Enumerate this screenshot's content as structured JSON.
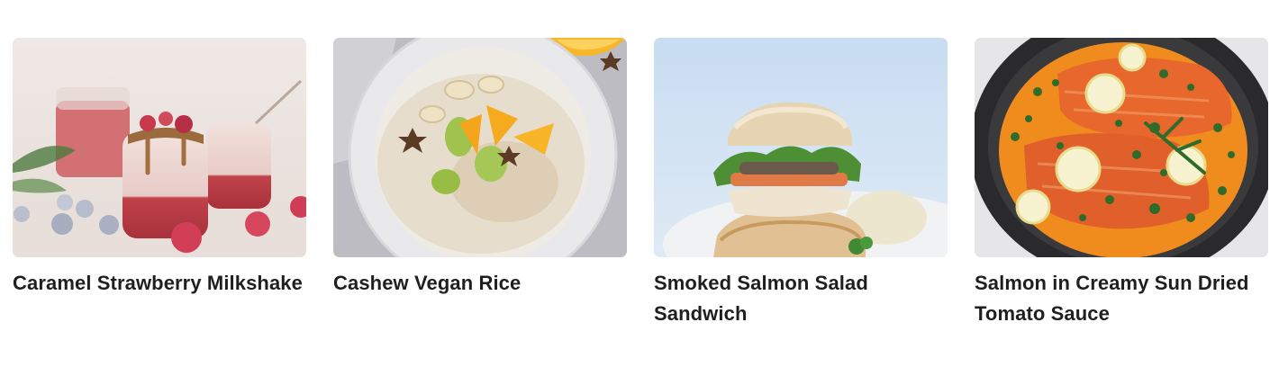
{
  "recipes": [
    {
      "title": "Caramel Strawberry Milkshake",
      "image": "milkshake-photo"
    },
    {
      "title": "Cashew Vegan Rice",
      "image": "rice-bowl-photo"
    },
    {
      "title": "Smoked Salmon Salad Sandwich",
      "image": "sandwich-photo"
    },
    {
      "title": "Salmon in Creamy Sun Dried Tomato Sauce",
      "image": "salmon-pan-photo"
    }
  ]
}
